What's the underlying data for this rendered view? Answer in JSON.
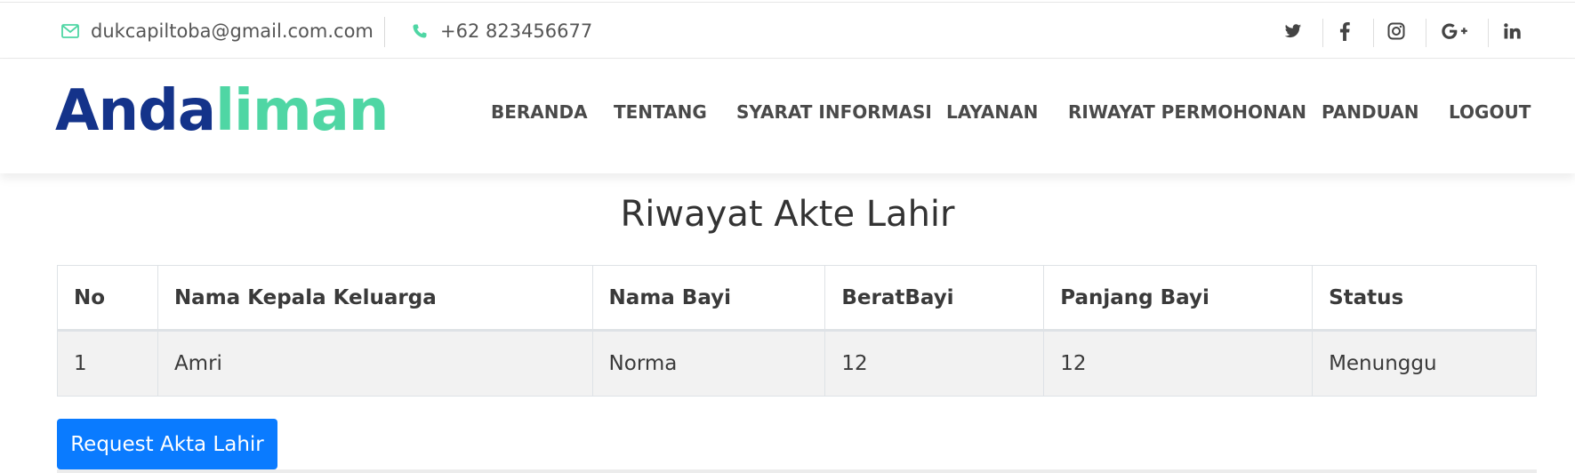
{
  "topbar": {
    "email": "dukcapiltoba@gmail.com.com",
    "phone": "+62 823456677",
    "social": [
      {
        "icon": "twitter-icon",
        "glyph": "t"
      },
      {
        "icon": "facebook-icon",
        "glyph": "f"
      },
      {
        "icon": "instagram-icon",
        "glyph": ""
      },
      {
        "icon": "google-plus-icon",
        "glyph": "G+"
      },
      {
        "icon": "linkedin-icon",
        "glyph": "in"
      }
    ]
  },
  "brand": {
    "part1": "Anda",
    "part2": "liman",
    "color1": "#14338a",
    "color2": "#4fd6a4"
  },
  "nav": {
    "items": [
      "BERANDA",
      "TENTANG",
      "SYARAT INFORMASI",
      "LAYANAN",
      "RIWAYAT PERMOHONAN",
      "PANDUAN",
      "LOGOUT"
    ]
  },
  "main": {
    "title": "Riwayat Akte Lahir",
    "table": {
      "headers": [
        "No",
        "Nama Kepala Keluarga",
        "Nama Bayi",
        "BeratBayi",
        "Panjang Bayi",
        "Status"
      ],
      "rows": [
        [
          "1",
          "Amri",
          "Norma",
          "12",
          "12",
          "Menunggu"
        ]
      ]
    },
    "request_button": "Request Akta Lahir"
  },
  "colors": {
    "accent": "#4fd6a4",
    "primary_button": "#0a7bff"
  }
}
